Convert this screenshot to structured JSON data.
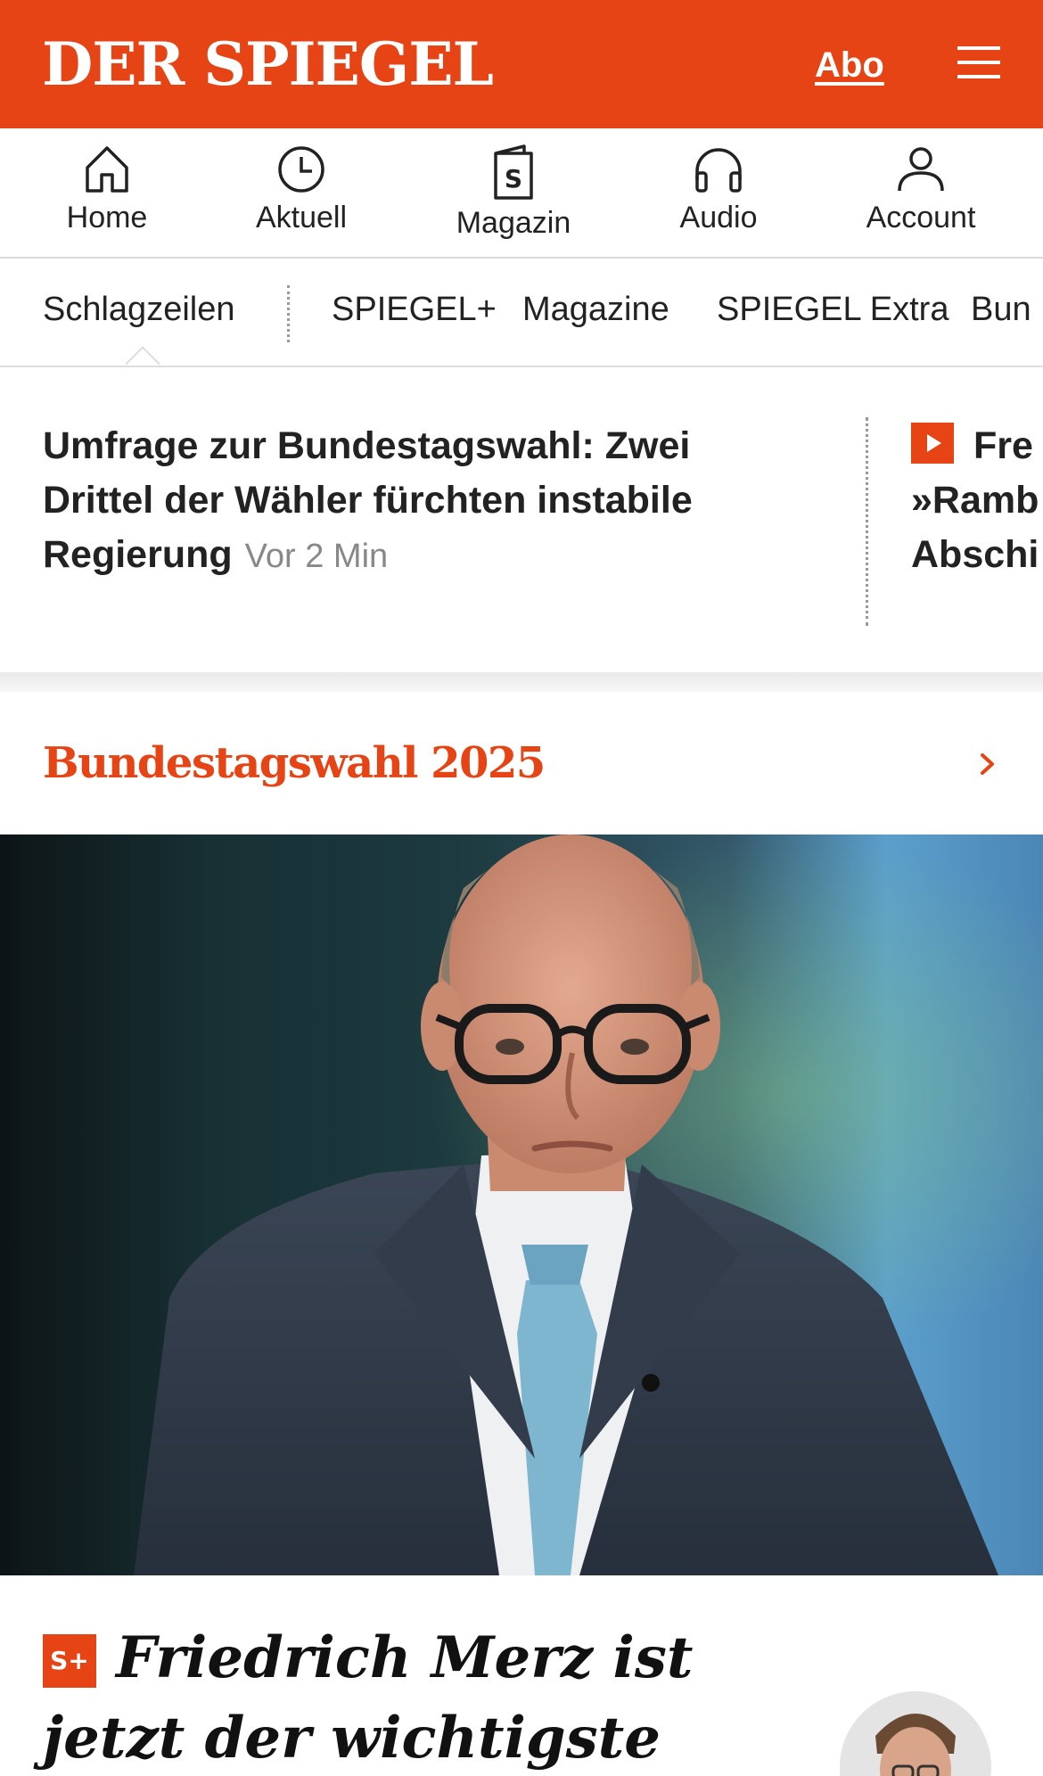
{
  "header": {
    "logo": "DER SPIEGEL",
    "abo_label": "Abo"
  },
  "quick_nav": [
    {
      "label": "Home",
      "icon": "home-icon"
    },
    {
      "label": "Aktuell",
      "icon": "clock-icon"
    },
    {
      "label": "Magazin",
      "icon": "magazine-icon"
    },
    {
      "label": "Audio",
      "icon": "headphones-icon"
    },
    {
      "label": "Account",
      "icon": "account-icon"
    }
  ],
  "section_tabs": [
    "Schlagzeilen",
    "SPIEGEL+",
    "Magazine",
    "SPIEGEL Extra",
    "Bun"
  ],
  "ticker": {
    "main_headline": "Umfrage zur Bundestagswahl: Zwei Drittel der Wähler fürchten instabile Regierung",
    "main_time": "Vor 2 Min",
    "side_line1": "Fre",
    "side_line2": "»Ramb",
    "side_line3": "Abschi"
  },
  "section": {
    "title": "Bundestagswahl 2025"
  },
  "article": {
    "badge": "S+",
    "title": "Friedrich Merz ist jetzt der wichtigste Mann"
  },
  "colors": {
    "brand": "#e64415",
    "text": "#222222",
    "muted": "#888888"
  }
}
